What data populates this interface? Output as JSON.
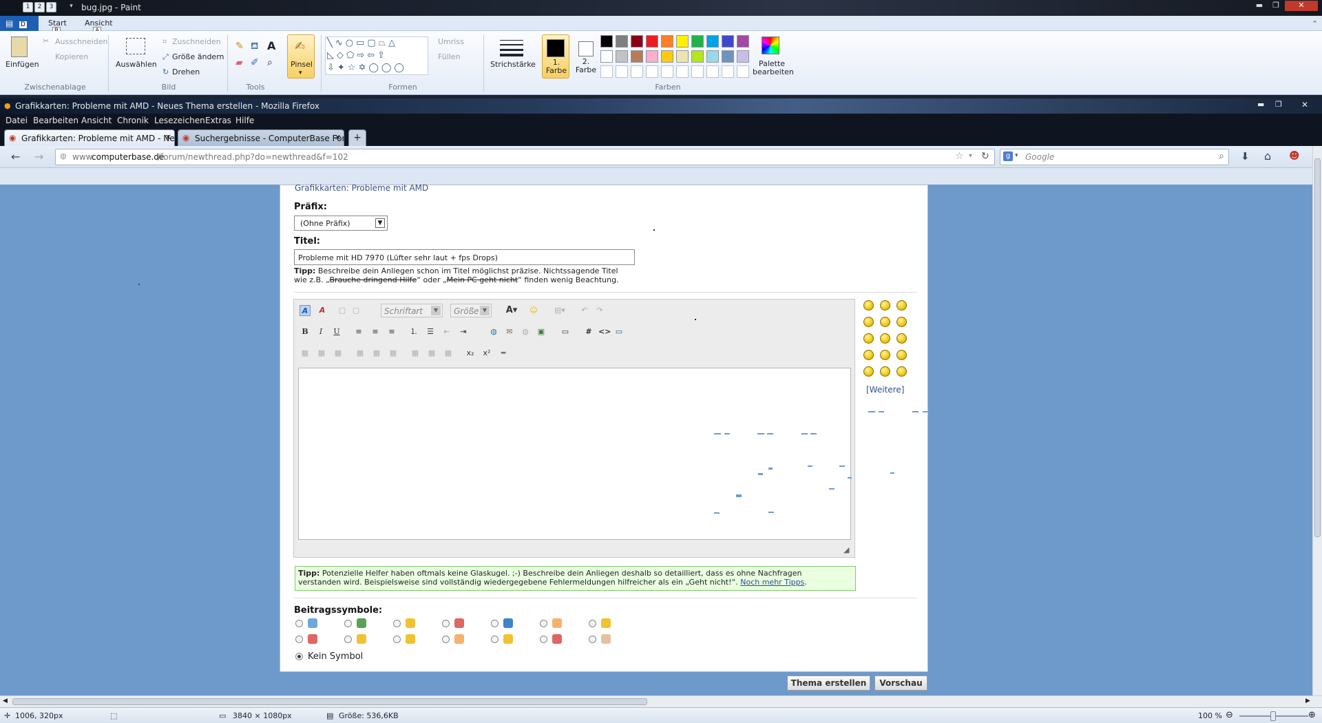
{
  "paint": {
    "title": "bug.jpg - Paint",
    "qat": [
      "1",
      "2",
      "3"
    ],
    "tab_keys": [
      "D",
      "R",
      "A"
    ],
    "tabs": [
      "Start",
      "Ansicht"
    ],
    "clipboard": {
      "paste": "Einfügen",
      "cut": "Ausschneiden",
      "copy": "Kopieren",
      "label": "Zwischenablage"
    },
    "image": {
      "select": "Auswählen",
      "crop": "Zuschneiden",
      "resize": "Größe ändern",
      "rotate": "Drehen",
      "label": "Bild"
    },
    "tools": {
      "label": "Tools",
      "brush": "Pinsel"
    },
    "shapes": {
      "outline": "Umriss",
      "fill": "Füllen",
      "label": "Formen"
    },
    "stroke": "Strichstärke",
    "color1": "1. Farbe",
    "color2": "2. Farbe",
    "colors_label": "Farben",
    "palette_edit": "Palette bearbeiten",
    "palette_row1": [
      "#000000",
      "#7f7f7f",
      "#880015",
      "#ed1c24",
      "#ff7f27",
      "#fff200",
      "#22b14c",
      "#00a2e8",
      "#3f48cc",
      "#a349a4"
    ],
    "palette_row2": [
      "#ffffff",
      "#c3c3c3",
      "#b97a57",
      "#ffaec9",
      "#ffc90e",
      "#efe4b0",
      "#b5e61d",
      "#99d9ea",
      "#7092be",
      "#c8bfe7"
    ]
  },
  "firefox": {
    "title": "Grafikkarten: Probleme mit AMD - Neues Thema erstellen - Mozilla Firefox",
    "menu": [
      "Datei",
      "Bearbeiten",
      "Ansicht",
      "Chronik",
      "Lesezeichen",
      "Extras",
      "Hilfe"
    ],
    "tabs": [
      "Grafikkarten: Probleme mit AMD - Ne...",
      "Suchergebnisse - ComputerBase Foru..."
    ],
    "new_tab": "+",
    "url_prefix": "www.",
    "url_domain": "computerbase.de",
    "url_path": "/forum/newthread.php?do=newthread&f=102",
    "search_placeholder": "Google"
  },
  "form": {
    "breadcrumb": "Grafikkarten: Probleme mit AMD",
    "prefix_label": "Präfix:",
    "prefix_value": "(Ohne Präfix)",
    "title_label": "Titel:",
    "title_value": "Probleme mit HD 7970 (Lüfter sehr laut + fps Drops)",
    "tip1_bold": "Tipp:",
    "tip1_text": "Beschreibe dein Anliegen schon im Titel möglichst präzise. Nichtssagende Titel",
    "tip1_line2_a": "wie z.B. „",
    "tip1_strike1": "Brauche dringend Hilfe",
    "tip1_line2_b": "“ oder „",
    "tip1_strike2": "Mein PC geht nicht",
    "tip1_line2_c": "“ finden wenig Beachtung.",
    "font_placeholder": "Schriftart",
    "size_placeholder": "Größe",
    "more_smilies": "[Weitere]",
    "tip2_bold": "Tipp:",
    "tip2_line1": "Potenzielle Helfer haben oftmals keine Glaskugel. ;-) Beschreibe dein Anliegen deshalb so detailliert, dass es ohne Nachfragen",
    "tip2_line2": "verstanden wird. Beispielsweise sind vollständig wiedergegebene Fehlermeldungen hilfreicher als ein „Geht nicht!“.",
    "tip2_link": "Noch mehr Tipps",
    "icons_label": "Beitragssymbole:",
    "no_symbol": "Kein Symbol",
    "submit": "Thema erstellen",
    "preview": "Vorschau"
  },
  "status": {
    "cursor": "1006, 320px",
    "dimensions": "3840 × 1080px",
    "size": "Größe: 536,6KB",
    "zoom": "100 %"
  }
}
